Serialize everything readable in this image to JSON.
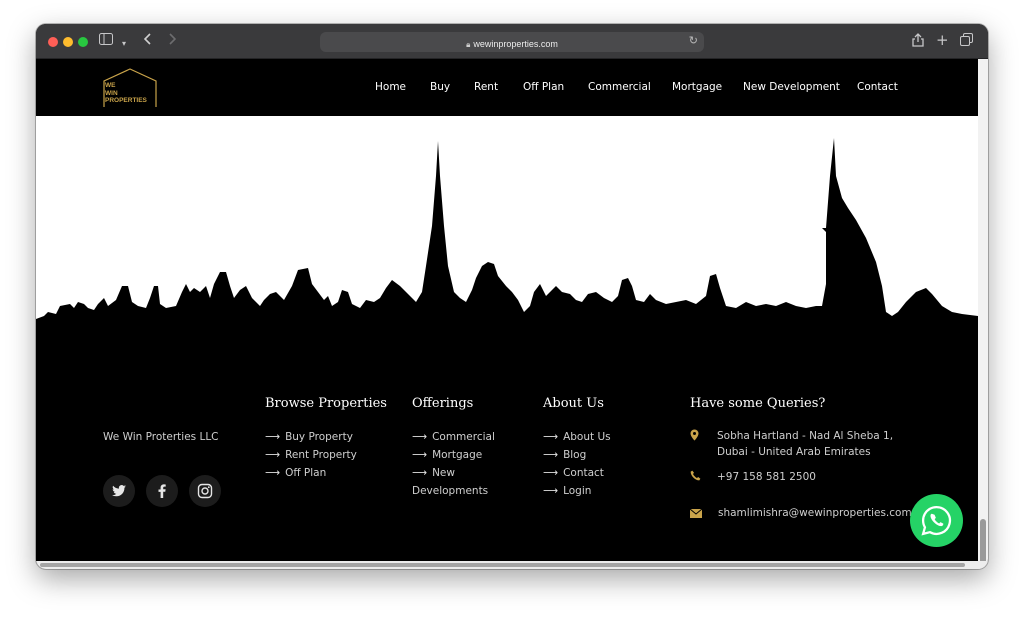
{
  "browser": {
    "url": "wewinproperties.com",
    "back_icon": "chevron-left-icon",
    "forward_icon": "chevron-right-icon"
  },
  "logo": {
    "line1": "WE",
    "line2": "WIN",
    "line3": "PROPERTIES"
  },
  "nav": {
    "items": [
      "Home",
      "Buy",
      "Rent",
      "Off Plan",
      "Commercial",
      "Mortgage",
      "New Development",
      "Contact"
    ]
  },
  "footer": {
    "company_name": "We Win Proterties LLC",
    "social": [
      "twitter-icon",
      "facebook-icon",
      "instagram-icon"
    ],
    "browse": {
      "title": "Browse Properties",
      "links": [
        "Buy Property",
        "Rent Property",
        "Off Plan"
      ]
    },
    "offerings": {
      "title": "Offerings",
      "links": [
        "Commercial",
        "Mortgage",
        "New",
        "Developments"
      ]
    },
    "about": {
      "title": "About Us",
      "links": [
        "About Us",
        "Blog",
        "Contact",
        "Login"
      ]
    },
    "queries": {
      "title": "Have some Queries?",
      "address_line1": "Sobha Hartland - Nad Al Sheba 1,",
      "address_line2": "Dubai - United Arab Emirates",
      "phone": "+97 158 581 2500",
      "email": "shamlimishra@wewinproperties.com"
    }
  },
  "colors": {
    "accent_gold": "#c9a34a",
    "whatsapp_green": "#25d366",
    "background": "#000000"
  }
}
